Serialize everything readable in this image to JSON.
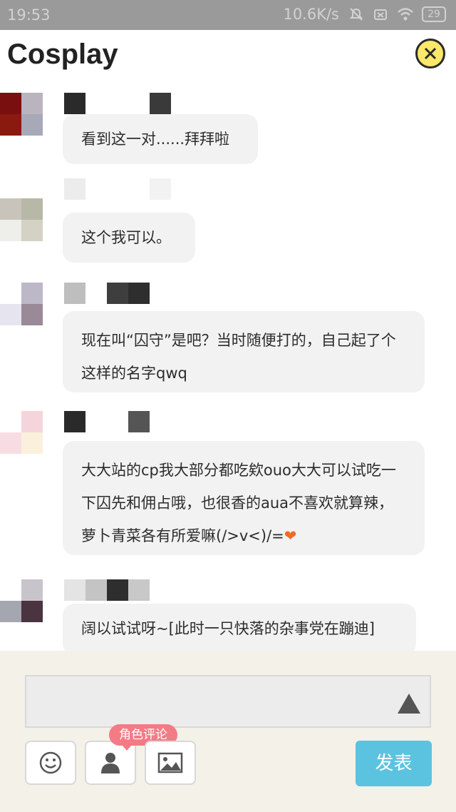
{
  "status_bar": {
    "time": "19:53",
    "network_speed": "10.6K/s",
    "battery": "29",
    "icons": [
      "mute-icon",
      "sim-icon",
      "wifi-icon",
      "battery-icon"
    ]
  },
  "header": {
    "title": "Cosplay",
    "close_icon": "close-icon",
    "close_color": "#fbe76a"
  },
  "messages": [
    {
      "text": "看到这一对......拜拜啦"
    },
    {
      "text": "这个我可以。"
    },
    {
      "text": "现在叫“囚守”是吧？当时随便打的，自己起了个这样的名字qwq"
    },
    {
      "text": "大大站的cp我大部分都吃欸ouo大大可以试吃一下囚先和佣占哦，也很香的aua不喜欢就算辣，萝卜青菜各有所爱嘛(/>v<)/=",
      "emoji": "heart"
    },
    {
      "text": "阔以试试呀~[此时一只快落的杂事党在蹦迪]"
    }
  ],
  "composer": {
    "input_value": "",
    "tools": [
      {
        "name": "emoji",
        "icon": "smiley-icon"
      },
      {
        "name": "role",
        "icon": "person-icon"
      },
      {
        "name": "image",
        "icon": "image-icon"
      }
    ],
    "role_badge": "角色评论",
    "publish_label": "发表",
    "publish_color": "#5bc3e0"
  }
}
